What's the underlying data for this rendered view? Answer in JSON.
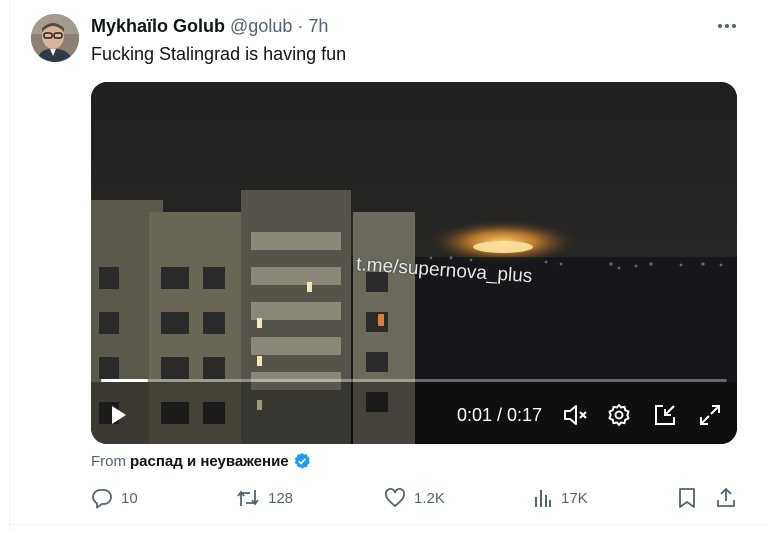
{
  "post": {
    "author_name": "Mykhaïlo Golub",
    "handle": "@golub",
    "separator": "·",
    "time": "7h",
    "text": "Fucking Stalingrad is having fun"
  },
  "video": {
    "watermark": "t.me/supernova_plus",
    "timecode": "0:01 / 0:17",
    "progress": 0.075
  },
  "source": {
    "label": "From",
    "name": "распад и неуважение"
  },
  "actions": {
    "replies": "10",
    "reposts": "128",
    "likes": "1.2K",
    "views": "17K"
  },
  "colors": {
    "verified_blue": "#1d9bf0",
    "muted_text": "#536471",
    "text": "#0f1419"
  },
  "icons": [
    "more-icon",
    "play-icon",
    "mute-icon",
    "settings-icon",
    "pip-icon",
    "fullscreen-icon",
    "verified-icon",
    "reply-icon",
    "repost-icon",
    "like-icon",
    "views-icon",
    "bookmark-icon",
    "share-icon"
  ]
}
